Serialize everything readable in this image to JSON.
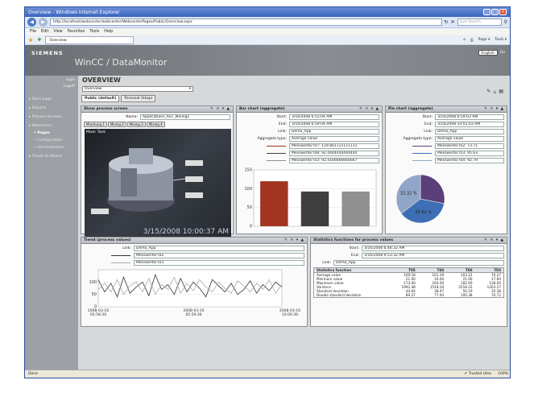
{
  "browser": {
    "title": "Overview - Windows Internet Explorer",
    "url": "http://localhost/webcenter/webcenter/WebcenterPages/Public/Overview.aspx",
    "search_placeholder": "Live Search",
    "menu": [
      "File",
      "Edit",
      "View",
      "Favorites",
      "Tools",
      "Help"
    ],
    "tab_label": "Overview",
    "tools": [
      "Page ▾",
      "Tools ▾"
    ],
    "status_left": "Done",
    "status_zone": "Trusted sites",
    "status_zoom": "100%"
  },
  "header": {
    "brand": "SIEMENS",
    "app_title": "WinCC / DataMonitor",
    "language": "English",
    "go_label": "Go"
  },
  "sidebar": {
    "login": "login",
    "logout": "Logoff",
    "items": [
      {
        "label": "Start page",
        "level": 0,
        "active": false
      },
      {
        "label": "Reports",
        "level": 0,
        "active": false
      },
      {
        "label": "Process Screens",
        "level": 0,
        "active": false
      },
      {
        "label": "Webcenter",
        "level": 0,
        "active": false
      },
      {
        "label": "Pages",
        "level": 1,
        "active": true
      },
      {
        "label": "Configuration",
        "level": 1,
        "active": false
      },
      {
        "label": "Administration",
        "level": 1,
        "active": false
      },
      {
        "label": "Trends & Alarms",
        "level": 0,
        "active": false
      }
    ]
  },
  "overview": {
    "title": "OVERVIEW",
    "select_value": "Overview",
    "tabs": [
      "Public (default)",
      "Personal (hkap)"
    ]
  },
  "process_screen": {
    "title": "Show process screen",
    "name_label": "Name:",
    "name_value": "Applications_AST_Mixing1",
    "tabs": [
      "Mischung 1",
      "Mixing 2",
      "Mixing 3",
      "Mixing 4"
    ],
    "screen_title": "Mixer Tank",
    "timestamp": "3/15/2008 10:00:37 AM"
  },
  "bar_chart": {
    "title": "Bar chart (aggregate)",
    "start_label": "Start:",
    "start": "3/16/2008 6:55:04 AM",
    "end_label": "End:",
    "end": "3/16/2008 6:59:04 AM",
    "link_label": "Link:",
    "link": "Demo_App",
    "agg_label": "Aggregate type:",
    "agg": "Average value",
    "legend": [
      {
        "text": "Messwerte/T07: 119.801111111111",
        "color": "#a23520"
      },
      {
        "text": "Messwerte/T08: 92.4444444444444",
        "color": "#3f3f3f"
      },
      {
        "text": "Messwerte/T03: 92.4166666666667",
        "color": "#909090"
      }
    ]
  },
  "pie_chart": {
    "title": "Pie chart (aggregate)",
    "start_label": "Start:",
    "start": "3/16/2008 6:59:03 AM",
    "end_label": "End:",
    "end": "3/16/2008 10:01:03 AM",
    "link_label": "Link:",
    "link": "Demo_App",
    "agg_label": "Aggregate type:",
    "agg": "Average value",
    "legend": [
      {
        "text": "Messwerte/T02: 73.71",
        "color": "#5a3f7a"
      },
      {
        "text": "Messwerte/T03: 95.63",
        "color": "#3e6fb4"
      },
      {
        "text": "Messwerte/T04: 92.79",
        "color": "#8fa6c8"
      }
    ]
  },
  "trend": {
    "title": "Trend (process values)",
    "link_label": "Link:",
    "link": "Demo_App",
    "legend": [
      {
        "text": "Messwerte/T02",
        "color": "#333333"
      },
      {
        "text": "Messwerte/T03",
        "color": "#aaaaaa"
      }
    ]
  },
  "stats": {
    "title": "Statistics functions for process values",
    "start_label": "Start:",
    "start": "3/16/2008 6:48:32 AM",
    "end_label": "End:",
    "end": "3/16/2008 9:53:32 AM",
    "link_label": "Link:",
    "link": "Demo_App",
    "columns": [
      "Statistics function",
      "T05",
      "T04",
      "T06",
      "T03"
    ],
    "rows": [
      [
        "Average value",
        "109.18",
        "101.39",
        "103.22",
        "70.27"
      ],
      [
        "Minimum value",
        "21.00",
        "16.00",
        "21.00",
        "17.00"
      ],
      [
        "Maximum value",
        "173.00",
        "164.00",
        "182.00",
        "128.00"
      ],
      [
        "Variance",
        "1992.48",
        "1518.34",
        "2518.22",
        "1263.27"
      ],
      [
        "Standard deviation",
        "44.64",
        "38.97",
        "50.19",
        "35.38"
      ],
      [
        "Double standard deviation",
        "89.27",
        "77.93",
        "100.38",
        "70.72"
      ]
    ]
  },
  "chart_data": [
    {
      "type": "bar",
      "title": "Bar chart (aggregate)",
      "categories": [
        "Messwerte/T07",
        "Messwerte/T08",
        "Messwerte/T03"
      ],
      "values": [
        119.8,
        92.44,
        92.42
      ],
      "colors": [
        "#a23520",
        "#3f3f3f",
        "#909090"
      ],
      "ylim": [
        0,
        150
      ],
      "yticks": [
        "150",
        "100",
        "50",
        "0"
      ],
      "grid": true
    },
    {
      "type": "pie",
      "title": "Pie chart (aggregate)",
      "labels": [
        "Messwerte/T02",
        "Messwerte/T03",
        "Messwerte/T04"
      ],
      "values": [
        73.71,
        95.63,
        92.79
      ],
      "colors": [
        "#5a3f7a",
        "#3e6fb4",
        "#8fa6c8"
      ],
      "slice_labels": [
        "",
        "35.61 %",
        "32.32 %"
      ]
    },
    {
      "type": "line",
      "title": "Trend (process values)",
      "xticks": [
        "2008-03-16\n05:58:36",
        "2008-03-16\n05:59:36",
        "2008-03-16\n10:00:36"
      ],
      "ylim": [
        0,
        150
      ],
      "yticks": [
        "100",
        "50",
        "0"
      ],
      "series": [
        {
          "name": "Messwerte/T02",
          "color": "#333333",
          "values": [
            110,
            60,
            95,
            40,
            120,
            55,
            80,
            100,
            45,
            130,
            70,
            90,
            50,
            115,
            60,
            100,
            75,
            40,
            110,
            85,
            60,
            95,
            50,
            70,
            105,
            55,
            90,
            65,
            100,
            80
          ]
        },
        {
          "name": "Messwerte/T03",
          "color": "#aaaaaa",
          "values": [
            70,
            95,
            60,
            110,
            50,
            85,
            100,
            60,
            115,
            50,
            90,
            70,
            120,
            55,
            95,
            65,
            110,
            80,
            60,
            100,
            75,
            55,
            105,
            85,
            60,
            95,
            70,
            110,
            55,
            90
          ]
        }
      ]
    }
  ]
}
